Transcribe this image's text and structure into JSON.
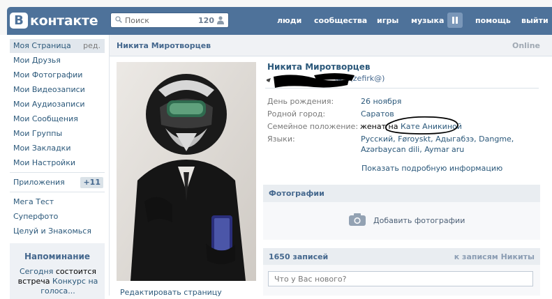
{
  "header": {
    "logo_letter": "В",
    "logo_text": "контакте",
    "search": {
      "placeholder": "Поиск",
      "count": "120"
    },
    "nav": [
      "люди",
      "сообщества",
      "игры",
      "музыка",
      "помощь",
      "выйти"
    ]
  },
  "sidebar": {
    "items": [
      {
        "label": "Моя Страница",
        "extra": "ред."
      },
      {
        "label": "Мои Друзья"
      },
      {
        "label": "Мои Фотографии"
      },
      {
        "label": "Мои Видеозаписи"
      },
      {
        "label": "Мои Аудиозаписи"
      },
      {
        "label": "Мои Сообщения"
      },
      {
        "label": "Мои Группы"
      },
      {
        "label": "Мои Закладки"
      },
      {
        "label": "Мои Настройки"
      }
    ],
    "apps": {
      "label": "Приложения",
      "badge": "+11"
    },
    "app_items": [
      "Мега Тест",
      "Суперфото",
      "Целуй и Знакомься"
    ],
    "reminder": {
      "title": "Напоминание",
      "line1_a": "Сегодня",
      "line1_b": "состоится",
      "line2_a": "встреча",
      "line2_b": "Конкурс на",
      "line3": "голоса..."
    }
  },
  "profile": {
    "header_name": "Никита Миротворцев",
    "online": "Online",
    "name": "Никита Миротворцев",
    "status_partial": "@...(zefirk@)",
    "fields": [
      {
        "label": "День рождения:",
        "value": "26 ноября"
      },
      {
        "label": "Родной город:",
        "value": "Саратов"
      },
      {
        "label": "Семейное положение:",
        "value_plain": "женат на",
        "value_link": "Кате Аникиной"
      },
      {
        "label": "Языки:",
        "value_line1": "Русский, Føroyskt, Адыгабзэ, Dangme,",
        "value_line2": "Azərbaycan dili, Aymar aru"
      }
    ],
    "more": "Показать подробную информацию",
    "edit_page": "Редактировать страницу"
  },
  "photos": {
    "title": "Фотографии",
    "add": "Добавить фотографии"
  },
  "wall": {
    "count": "1650 записей",
    "right": "к записям Никиты",
    "placeholder": "Что у Вас нового?"
  },
  "colors": {
    "header_blue": "#4e729a",
    "link": "#2b587a",
    "block_bg": "#e9edf1"
  }
}
